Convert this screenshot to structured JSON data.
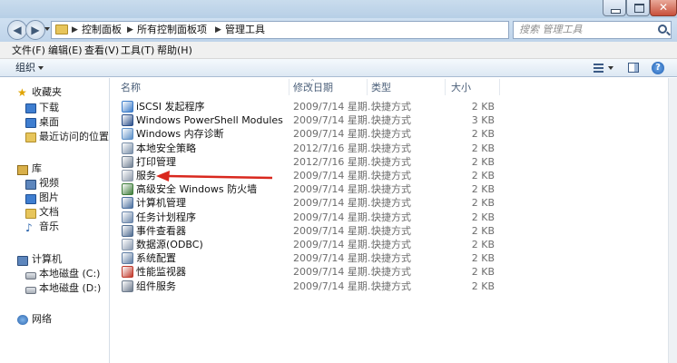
{
  "address": {
    "crumbs": [
      "控制面板",
      "所有控制面板项",
      "管理工具"
    ]
  },
  "search": {
    "placeholder": "搜索 管理工具"
  },
  "menu": [
    "文件(F)",
    "编辑(E)",
    "查看(V)",
    "工具(T)",
    "帮助(H)"
  ],
  "toolbar": {
    "organize_label": "组织"
  },
  "nav": {
    "favorites": "收藏夹",
    "fav_items": [
      "下载",
      "桌面",
      "最近访问的位置"
    ],
    "libraries": "库",
    "lib_items": [
      "视频",
      "图片",
      "文档",
      "音乐"
    ],
    "computer": "计算机",
    "comp_items": [
      "本地磁盘 (C:)",
      "本地磁盘 (D:)"
    ],
    "network": "网络"
  },
  "columns": {
    "name": "名称",
    "date": "修改日期",
    "type": "类型",
    "size": "大小"
  },
  "files": [
    {
      "name": "iSCSI 发起程序",
      "date": "2009/7/14 星期...",
      "type": "快捷方式",
      "size": "2 KB",
      "icon": "iscsi-icon",
      "color": "#3b7bc9"
    },
    {
      "name": "Windows PowerShell Modules",
      "date": "2009/7/14 星期...",
      "type": "快捷方式",
      "size": "3 KB",
      "icon": "powershell-icon",
      "color": "#2b4f8a"
    },
    {
      "name": "Windows 内存诊断",
      "date": "2009/7/14 星期...",
      "type": "快捷方式",
      "size": "2 KB",
      "icon": "memory-diagnostic-icon",
      "color": "#5b8fc7"
    },
    {
      "name": "本地安全策略",
      "date": "2012/7/16 星期...",
      "type": "快捷方式",
      "size": "2 KB",
      "icon": "security-policy-icon",
      "color": "#7a8fa8"
    },
    {
      "name": "打印管理",
      "date": "2012/7/16 星期...",
      "type": "快捷方式",
      "size": "2 KB",
      "icon": "print-management-icon",
      "color": "#6f7f92"
    },
    {
      "name": "服务",
      "date": "2009/7/14 星期...",
      "type": "快捷方式",
      "size": "2 KB",
      "icon": "services-icon",
      "color": "#8e9aab"
    },
    {
      "name": "高级安全 Windows 防火墙",
      "date": "2009/7/14 星期...",
      "type": "快捷方式",
      "size": "2 KB",
      "icon": "firewall-icon",
      "color": "#3e7d3a"
    },
    {
      "name": "计算机管理",
      "date": "2009/7/14 星期...",
      "type": "快捷方式",
      "size": "2 KB",
      "icon": "computer-management-icon",
      "color": "#4a6f9e"
    },
    {
      "name": "任务计划程序",
      "date": "2009/7/14 星期...",
      "type": "快捷方式",
      "size": "2 KB",
      "icon": "task-scheduler-icon",
      "color": "#6b86aa"
    },
    {
      "name": "事件查看器",
      "date": "2009/7/14 星期...",
      "type": "快捷方式",
      "size": "2 KB",
      "icon": "event-viewer-icon",
      "color": "#4d6a8f"
    },
    {
      "name": "数据源(ODBC)",
      "date": "2009/7/14 星期...",
      "type": "快捷方式",
      "size": "2 KB",
      "icon": "odbc-icon",
      "color": "#8a9ab0"
    },
    {
      "name": "系统配置",
      "date": "2009/7/14 星期...",
      "type": "快捷方式",
      "size": "2 KB",
      "icon": "system-config-icon",
      "color": "#5f7da3"
    },
    {
      "name": "性能监视器",
      "date": "2009/7/14 星期...",
      "type": "快捷方式",
      "size": "2 KB",
      "icon": "performance-monitor-icon",
      "color": "#c0392b"
    },
    {
      "name": "组件服务",
      "date": "2009/7/14 星期...",
      "type": "快捷方式",
      "size": "2 KB",
      "icon": "component-services-icon",
      "color": "#6c7a8c"
    }
  ],
  "annotation_color": "#d9281e"
}
